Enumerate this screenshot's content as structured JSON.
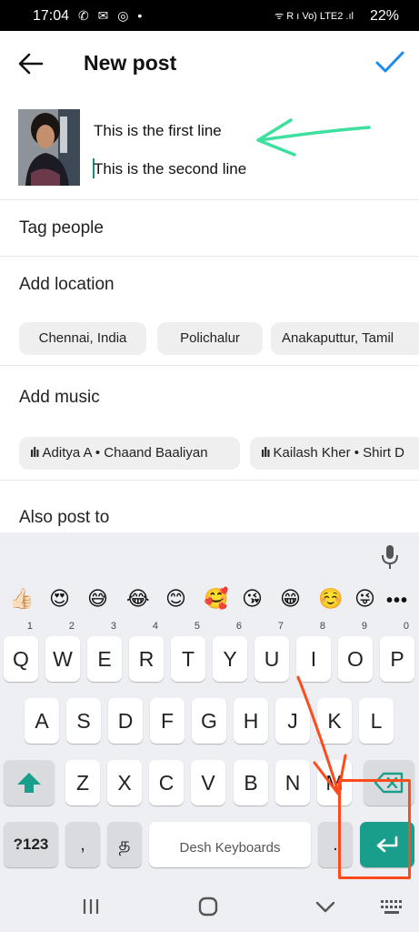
{
  "status_bar": {
    "time": "17:04",
    "left_icons": "✆ ✉ ◎ •",
    "network": "ᯤ R ı Vo) LTE2 .ıl",
    "battery": "22%"
  },
  "header": {
    "title": "New post"
  },
  "composer": {
    "line1": "This is the first line",
    "line2": "This is the second line"
  },
  "rows": {
    "tag_people": "Tag people",
    "add_location": "Add location",
    "add_music": "Add music",
    "also_post_to": "Also post to"
  },
  "location_chips": [
    "Chennai, India",
    "Polichalur",
    "Anakaputtur, Tamil"
  ],
  "music_chips": [
    {
      "bars": "ılı",
      "label": "Aditya A • Chaand Baaliyan"
    },
    {
      "bars": "ılı",
      "label": "Kailash Kher • Shirt D"
    }
  ],
  "keyboard": {
    "emojis": [
      "👍🏻",
      "😍",
      "😅",
      "😂",
      "😊",
      "🥰",
      "😘",
      "😁",
      "☺️",
      "😜"
    ],
    "more": "•••",
    "row1": [
      {
        "k": "Q",
        "n": "1"
      },
      {
        "k": "W",
        "n": "2"
      },
      {
        "k": "E",
        "n": "3"
      },
      {
        "k": "R",
        "n": "4"
      },
      {
        "k": "T",
        "n": "5"
      },
      {
        "k": "Y",
        "n": "6"
      },
      {
        "k": "U",
        "n": "7"
      },
      {
        "k": "I",
        "n": "8"
      },
      {
        "k": "O",
        "n": "9"
      },
      {
        "k": "P",
        "n": "0"
      }
    ],
    "row2": [
      "A",
      "S",
      "D",
      "F",
      "G",
      "H",
      "J",
      "K",
      "L"
    ],
    "row3": [
      "Z",
      "X",
      "C",
      "V",
      "B",
      "N",
      "M"
    ],
    "symbols_label": "?123",
    "comma": ",",
    "lang_glyph": "த",
    "space_label": "Desh Keyboards",
    "period": "."
  },
  "colors": {
    "accent_blue": "#1d8bf0",
    "keyboard_teal": "#1a9e8c",
    "annotation_green": "#3ee0a0",
    "annotation_red": "#ff4a1c"
  }
}
